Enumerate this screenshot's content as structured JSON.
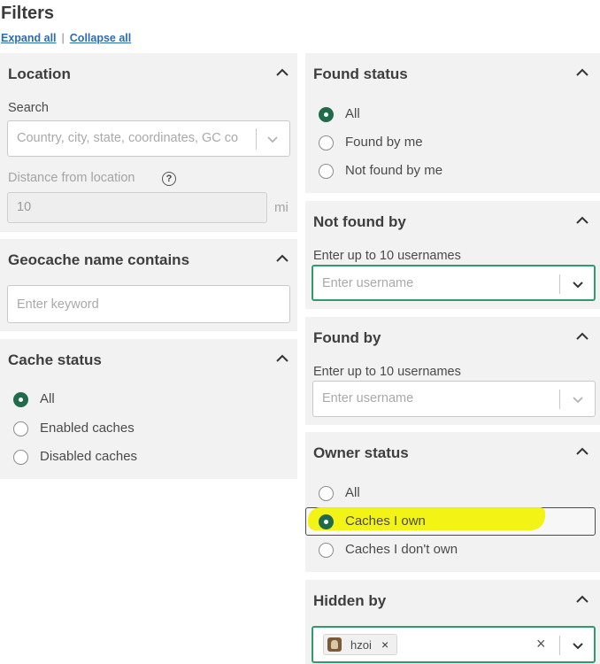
{
  "page": {
    "title": "Filters",
    "expand_all": "Expand all",
    "collapse_all": "Collapse all"
  },
  "location": {
    "header": "Location",
    "search_label": "Search",
    "search_placeholder": "Country, city, state, coordinates, GC co",
    "distance_label": "Distance from location",
    "help_glyph": "?",
    "distance_value": "10",
    "distance_unit": "mi"
  },
  "name_contains": {
    "header": "Geocache name contains",
    "placeholder": "Enter keyword"
  },
  "cache_status": {
    "header": "Cache status",
    "options": [
      "All",
      "Enabled caches",
      "Disabled caches"
    ],
    "selected": "All"
  },
  "found_status": {
    "header": "Found status",
    "options": [
      "All",
      "Found by me",
      "Not found by me"
    ],
    "selected": "All"
  },
  "not_found_by": {
    "header": "Not found by",
    "hint": "Enter up to 10 usernames",
    "placeholder": "Enter username"
  },
  "found_by": {
    "header": "Found by",
    "hint": "Enter up to 10 usernames",
    "placeholder": "Enter username"
  },
  "owner_status": {
    "header": "Owner status",
    "options": [
      "All",
      "Caches I own",
      "Caches I don't own"
    ],
    "selected": "Caches I own"
  },
  "hidden_by": {
    "header": "Hidden by",
    "chip_label": "hzoi",
    "chip_remove": "×",
    "clear_all": "×"
  },
  "colors": {
    "panel_bg": "#f2f2f2",
    "radio_selected": "#1f6b4a",
    "focus_border": "#2e9c6b",
    "link": "#2b6cb5",
    "highlight_marker": "#f3f20a"
  },
  "icons": {
    "panel_toggle": "chevron-up-icon",
    "dropdown": "chevron-down-icon",
    "help": "question-circle-icon",
    "avatar": "user-avatar"
  }
}
